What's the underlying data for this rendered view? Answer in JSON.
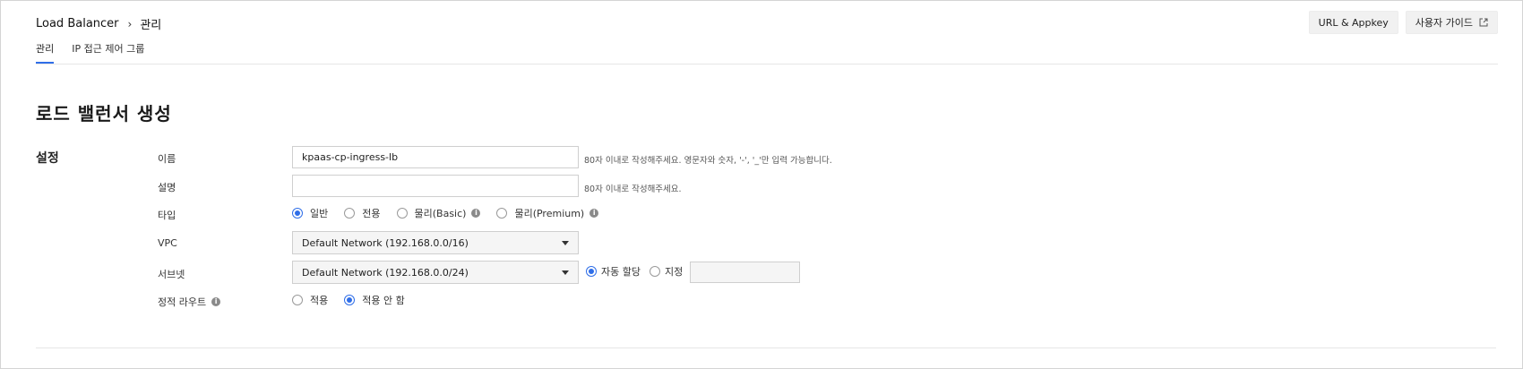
{
  "breadcrumb": {
    "root": "Load Balancer",
    "separator": "›",
    "current": "관리"
  },
  "top_buttons": {
    "url_appkey": "URL & Appkey",
    "user_guide": "사용자 가이드"
  },
  "tabs": [
    {
      "label": "관리",
      "active": true
    },
    {
      "label": "IP 접근 제어 그룹",
      "active": false
    }
  ],
  "page_title": "로드 밸런서 생성",
  "section_title": "설정",
  "fields": {
    "name": {
      "label": "이름",
      "value": "kpaas-cp-ingress-lb",
      "help": "80자 이내로 작성해주세요. 영문자와 숫자, '-', '_'만 입력 가능합니다."
    },
    "description": {
      "label": "설명",
      "value": "",
      "help": "80자 이내로 작성해주세요."
    },
    "type": {
      "label": "타입",
      "options": [
        {
          "label": "일반",
          "checked": true
        },
        {
          "label": "전용",
          "checked": false
        },
        {
          "label": "물리(Basic)",
          "checked": false
        },
        {
          "label": "물리(Premium)",
          "checked": false
        }
      ]
    },
    "vpc": {
      "label": "VPC",
      "selected": "Default Network (192.168.0.0/16)"
    },
    "subnet": {
      "label": "서브넷",
      "selected": "Default Network (192.168.0.0/24)",
      "options": [
        {
          "label": "자동 할당",
          "checked": true
        },
        {
          "label": "지정",
          "checked": false
        }
      ]
    },
    "static_route": {
      "label": "정적 라우트",
      "options": [
        {
          "label": "적용",
          "checked": false
        },
        {
          "label": "적용 안 함",
          "checked": true
        }
      ]
    }
  },
  "colors": {
    "accent": "#2f6ee8",
    "info_icon": "#8a8a8a"
  }
}
